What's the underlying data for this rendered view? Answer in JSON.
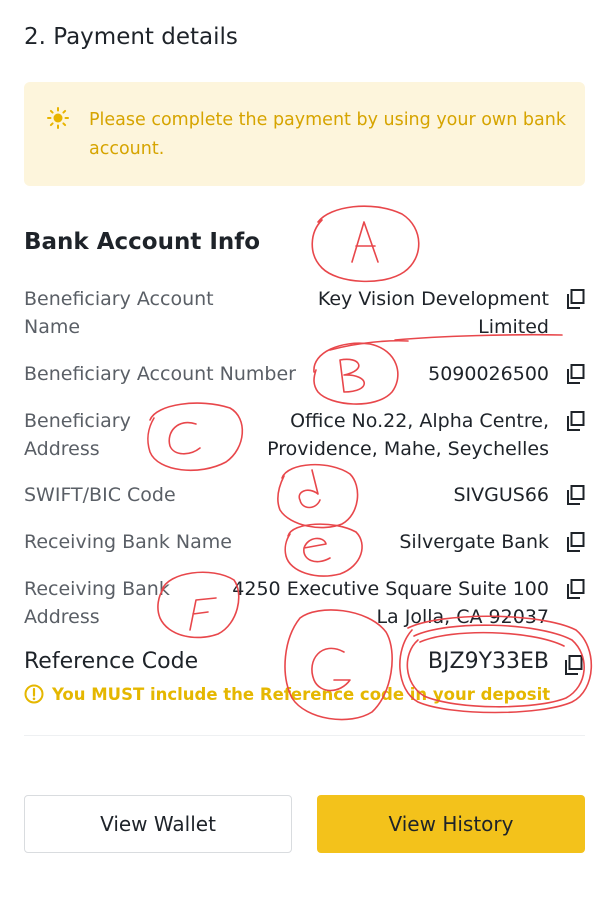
{
  "section": {
    "title": "2. Payment details"
  },
  "notice": {
    "icon": "sun-icon",
    "text": "Please complete the payment by using your own bank account.",
    "color": "#d6a400",
    "background": "#fdf5dc"
  },
  "bank": {
    "heading": "Bank Account Info",
    "rows": [
      {
        "label": "Beneficiary Account Name",
        "value": "Key Vision Development Limited"
      },
      {
        "label": "Beneficiary Account Number",
        "value": "5090026500"
      },
      {
        "label": "Beneficiary Address",
        "value": "Office No.22, Alpha Centre, Providence, Mahe, Seychelles"
      },
      {
        "label": "SWIFT/BIC Code",
        "value": "SIVGUS66"
      },
      {
        "label": "Receiving Bank Name",
        "value": "Silvergate Bank"
      },
      {
        "label": "Receiving Bank Address",
        "value": "4250 Executive Square Suite 100 La Jolla, CA 92037"
      }
    ],
    "copy_icon": "copy-icon"
  },
  "reference": {
    "label": "Reference Code",
    "value": "BJZ9Y33EB",
    "warning": "You MUST include the Reference code in your deposit",
    "warning_icon": "exclamation-circle-icon"
  },
  "buttons": {
    "view_wallet": "View Wallet",
    "view_history": "View History",
    "primary_color": "#f3c21b"
  },
  "annotations": {
    "letters": [
      "A",
      "B",
      "C",
      "d",
      "e",
      "F",
      "G"
    ],
    "color": "#e8474b"
  }
}
